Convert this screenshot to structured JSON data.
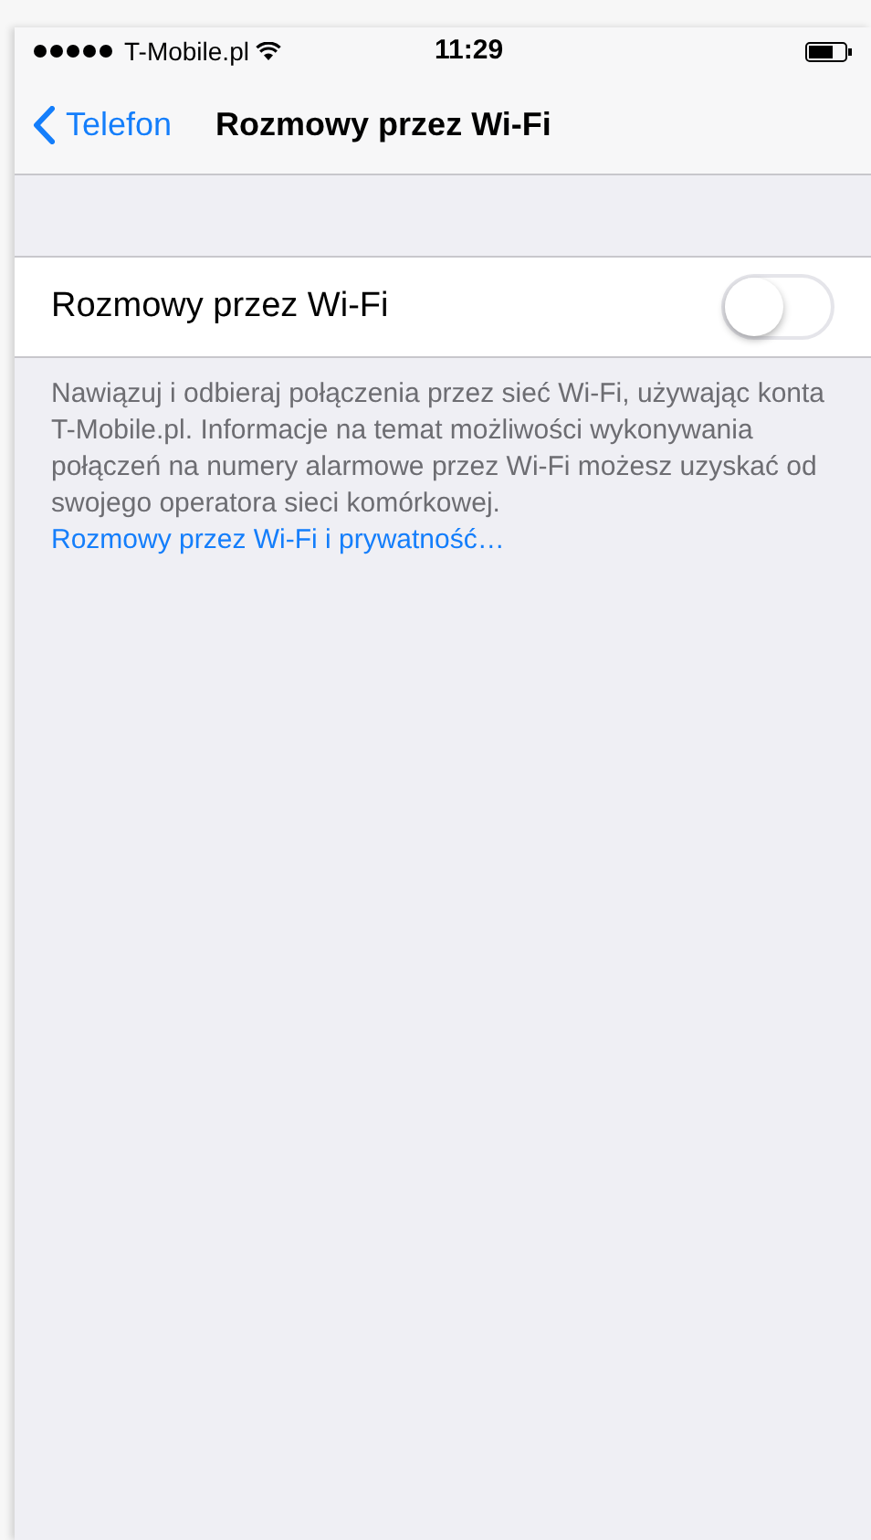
{
  "status_bar": {
    "carrier": "T-Mobile.pl",
    "time": "11:29"
  },
  "nav": {
    "back": "Telefon",
    "title": "Rozmowy przez Wi-Fi"
  },
  "setting": {
    "label": "Rozmowy przez Wi-Fi",
    "on": false
  },
  "footer": {
    "text": "Nawiązuj i odbieraj połączenia przez sieć Wi-Fi, używając konta T-Mobile.pl. Informacje na temat możliwości wykonywania połączeń na numery alarmowe przez Wi-Fi możesz uzyskać od swojego operatora sieci komórkowej.",
    "link": "Rozmowy przez Wi-Fi i prywatność…"
  }
}
